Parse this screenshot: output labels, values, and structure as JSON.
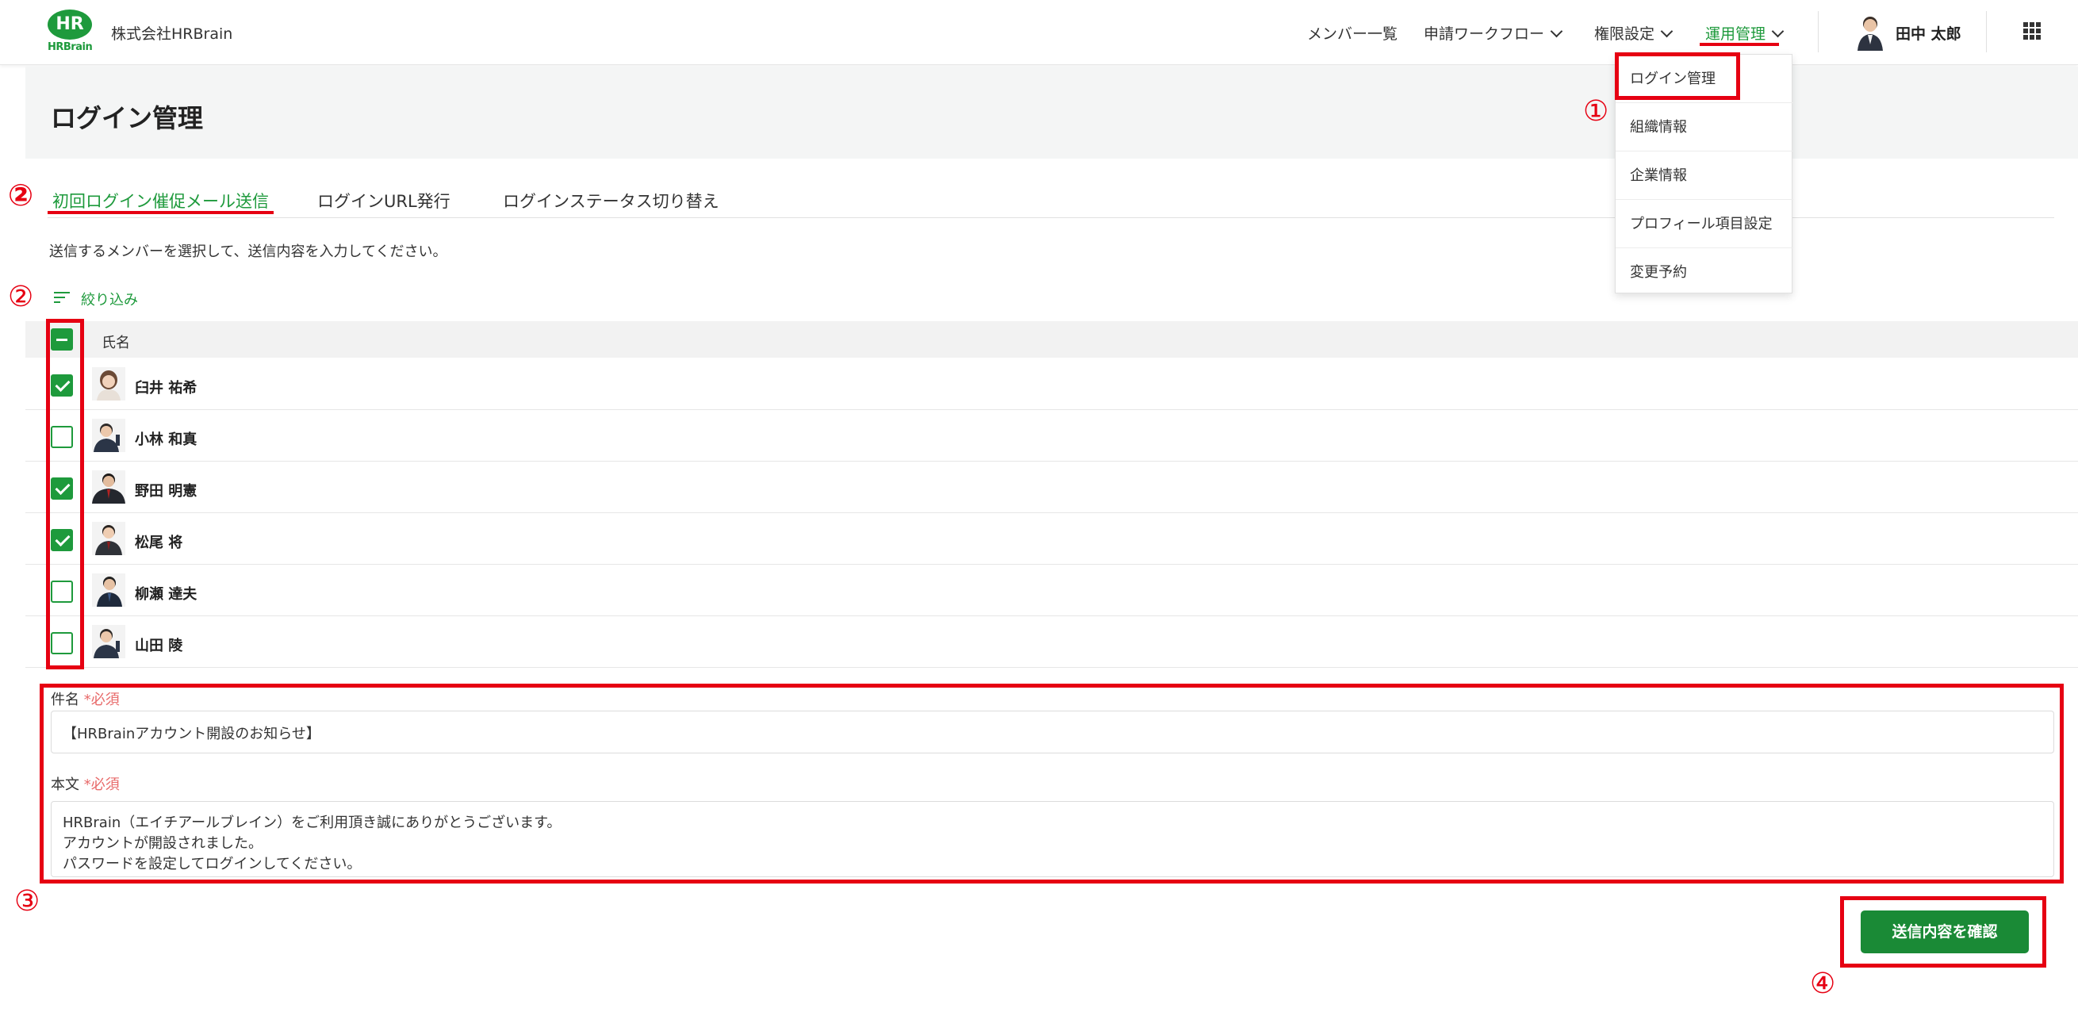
{
  "header": {
    "logo_mark": "HR",
    "logo_brand": "HRBrain",
    "company": "株式会社HRBrain",
    "nav": [
      {
        "label": "メンバー一覧",
        "has_chevron": false
      },
      {
        "label": "申請ワークフロー",
        "has_chevron": true
      },
      {
        "label": "権限設定",
        "has_chevron": true
      },
      {
        "label": "運用管理",
        "has_chevron": true
      }
    ],
    "user_name": "田中 太郎"
  },
  "dropdown": {
    "items": [
      "ログイン管理",
      "組織情報",
      "企業情報",
      "プロフィール項目設定",
      "変更予約"
    ]
  },
  "page": {
    "title": "ログイン管理",
    "tabs": [
      "初回ログイン催促メール送信",
      "ログインURL発行",
      "ログインステータス切り替え"
    ],
    "instruction": "送信するメンバーを選択して、送信内容を入力してください。",
    "filter_label": "絞り込み"
  },
  "table": {
    "column_name": "氏名",
    "rows": [
      {
        "name": "臼井 祐希",
        "checked": true
      },
      {
        "name": "小林 和真",
        "checked": false
      },
      {
        "name": "野田 明憲",
        "checked": true
      },
      {
        "name": "松尾 将",
        "checked": true
      },
      {
        "name": "柳瀬 達夫",
        "checked": false
      },
      {
        "name": "山田 陵",
        "checked": false
      }
    ]
  },
  "form": {
    "subject_label": "件名",
    "required_mark": "*必須",
    "subject_value": "【HRBrainアカウント開設のお知らせ】",
    "body_label": "本文",
    "body_lines": [
      "HRBrain（エイチアールブレイン）をご利用頂き誠にありがとうございます。",
      "アカウントが開設されました。",
      "パスワードを設定してログインしてください。"
    ],
    "confirm_button": "送信内容を確認"
  },
  "annotations": {
    "step1": "①",
    "step2": "②",
    "step3": "③",
    "step4": "④"
  },
  "colors": {
    "brand_green": "#1e9a3c",
    "button_green": "#1a8a36",
    "annotation_red": "#e60012",
    "required_red": "#e86a6a"
  }
}
